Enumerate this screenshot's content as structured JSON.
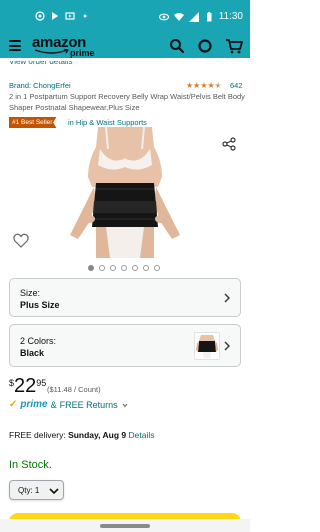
{
  "status_bar": {
    "time": "11:30",
    "left_icons": [
      "whatsapp-icon",
      "play-store-icon",
      "media-icon",
      "dot-icon"
    ],
    "right_icons": [
      "eye-icon",
      "wifi-icon",
      "signal-icon",
      "battery-icon"
    ],
    "color": "#1aa5b5"
  },
  "header": {
    "logo_text": "amazon",
    "logo_sub": "prime",
    "icons": [
      "menu-icon",
      "search-icon",
      "alexa-icon",
      "cart-icon"
    ]
  },
  "peek_text": "View order details",
  "product": {
    "brand": "Brand: ChongErfei",
    "rating_out_of_5": 4.5,
    "rating_count": "642",
    "title": "2 in 1 Postpartum Support Recovery Belly Wrap Waist/Pelvis Belt Body Shaper Postnatal Shapewear,Plus Size",
    "badge": "#1 Best Seller",
    "badge_category": "in Hip & Waist Supports",
    "image_count": 7,
    "active_image_index": 0
  },
  "variations": {
    "size": {
      "label": "Size:",
      "value": "Plus Size"
    },
    "color": {
      "label": "2 Colors:",
      "value": "Black"
    }
  },
  "price": {
    "currency": "$",
    "whole": "22",
    "fraction": "95",
    "unit_price": "($11.48 / Count)"
  },
  "prime": {
    "word": "prime",
    "connector": "&",
    "returns": "FREE Returns"
  },
  "delivery": {
    "prefix": "FREE delivery:",
    "date": "Sunday, Aug 9",
    "link": "Details"
  },
  "stock": "In Stock.",
  "quantity": {
    "label": "Qty: 1"
  },
  "colors": {
    "accent_teal": "#1aa5b5",
    "link": "#00707a",
    "badge": "#c45500",
    "stock_green": "#007600",
    "star": "#de7921",
    "cart_yellow": "#ffd814"
  }
}
